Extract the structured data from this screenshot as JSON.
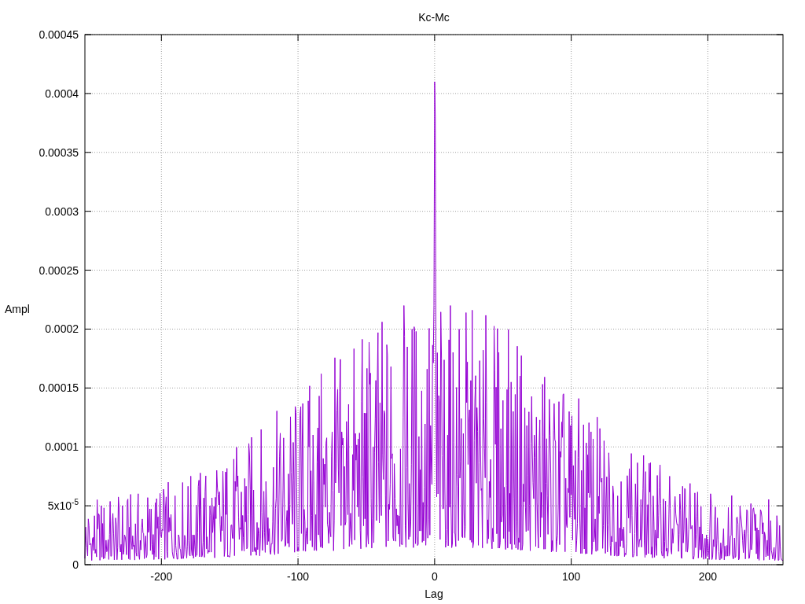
{
  "plot": {
    "title": "Kc-Mc",
    "xlabel": "Lag",
    "ylabel": "Ampl",
    "yticks": [
      "0.00045",
      "0.0004",
      "0.00035",
      "0.0003",
      "0.00025",
      "0.0002",
      "0.00015",
      "0.0001",
      "5x10$^{-5}$",
      "0"
    ],
    "xticks": [
      "-200",
      "-100",
      "0",
      "100",
      "200"
    ]
  }
}
